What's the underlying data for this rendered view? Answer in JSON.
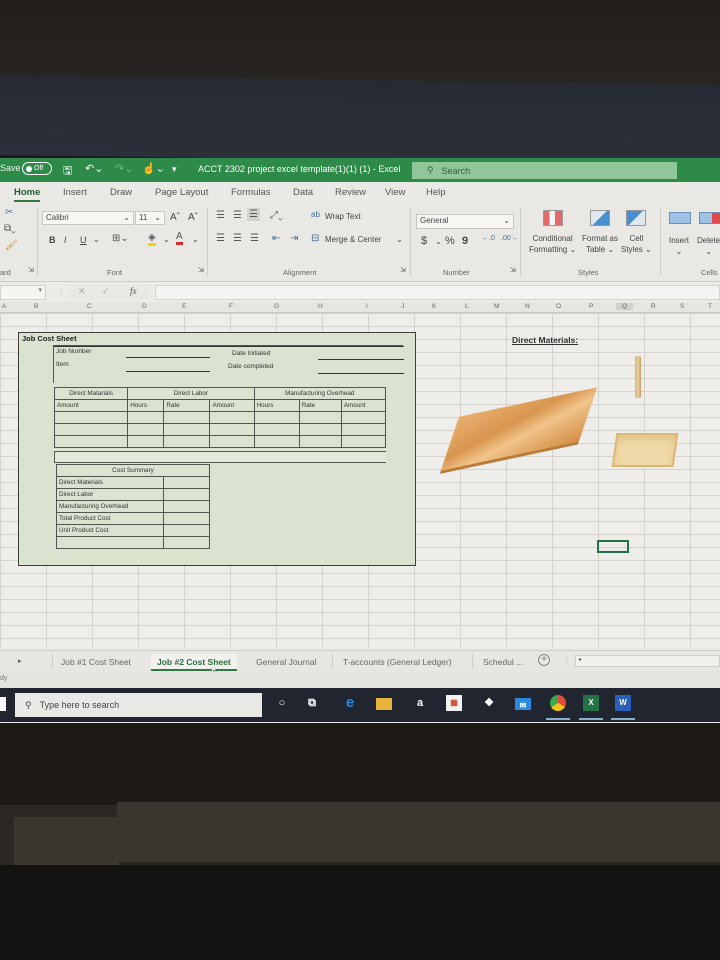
{
  "titlebar": {
    "autosave_label": "Save",
    "autosave_state": "Off",
    "doc_title": "ACCT 2302 project excel template(1)(1) (1)  -  Excel",
    "search_placeholder": "Search"
  },
  "menu": {
    "tabs": [
      "Home",
      "Insert",
      "Draw",
      "Page Layout",
      "Formulas",
      "Data",
      "Review",
      "View",
      "Help"
    ],
    "active": "Home"
  },
  "ribbon": {
    "clipboard_label": "ard",
    "font_name": "Calibri",
    "font_size": "11",
    "font_group_label": "Font",
    "bold": "B",
    "italic": "I",
    "underline": "U",
    "wrap_text": "Wrap Text",
    "merge_center": "Merge & Center",
    "alignment_label": "Alignment",
    "number_format": "General",
    "currency": "$",
    "percent": "%",
    "comma": "9",
    "number_label": "Number",
    "conditional_formatting": [
      "Conditional",
      "Formatting ⌄"
    ],
    "format_as_table": [
      "Format as",
      "Table ⌄"
    ],
    "cell_styles": [
      "Cell",
      "Styles ⌄"
    ],
    "styles_label": "Styles",
    "insert": "Insert",
    "delete": "Delete",
    "cells_label": "Cells"
  },
  "formula_bar": {
    "fx": "fx",
    "cancel": "✕",
    "enter": "✓",
    "value": ""
  },
  "columns": [
    "A",
    "B",
    "C",
    "D",
    "E",
    "F",
    "G",
    "H",
    "I",
    "J",
    "K",
    "L",
    "M",
    "N",
    "O",
    "P",
    "Q",
    "R",
    "S",
    "T"
  ],
  "job_cost_sheet": {
    "title": "Job Cost Sheet",
    "job_number_label": "Job Number",
    "item_label": "Item",
    "date_initiated_label": "Date Initiated",
    "date_completed_label": "Date completed",
    "groups": [
      "Direct Matarials",
      "Direct Labor",
      "Manufacturing Overhead"
    ],
    "columns": [
      "Amount",
      "Hours",
      "Rate",
      "Amount",
      "Hours",
      "Rate",
      "Amount"
    ],
    "cost_summary": {
      "title": "Cost Summary",
      "rows": [
        "Direct Materials",
        "Direct Labor",
        "Manufacturing Overhead",
        "Total Product Cost",
        "Unit Product Cost",
        ""
      ]
    }
  },
  "direct_materials": {
    "title": "Direct Materials:",
    "images": [
      "wood-board-image",
      "table-leg-image",
      "wood-drawer-image"
    ]
  },
  "sheet_tabs": {
    "items": [
      "Job #1 Cost Sheet",
      "Job #2 Cost Sheet",
      "General Journal",
      "T-accounts (General Ledger)",
      "Schedul ..."
    ],
    "active": "Job #2 Cost Sheet"
  },
  "status": {
    "text": "dy"
  },
  "taskbar": {
    "search_placeholder": "Type here to search",
    "apps": [
      "cortana",
      "task-view",
      "edge",
      "file-explorer",
      "amazon",
      "store",
      "dropbox",
      "mail",
      "chrome",
      "excel",
      "word"
    ]
  }
}
